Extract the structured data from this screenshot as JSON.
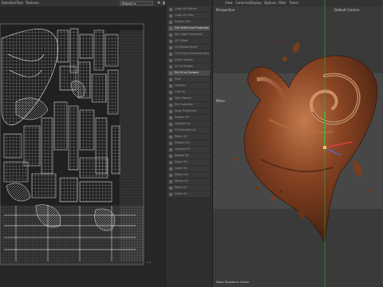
{
  "topbar": {
    "menus": [
      "Selection",
      "Tiles",
      "Textures"
    ],
    "dropdown_value": "Project",
    "icons": [
      "pin-icon",
      "grid-icon",
      "cursor-icon",
      "circle-icon"
    ]
  },
  "side_panel": {
    "items": [
      {
        "label": "Copy UV Seams",
        "highlight": false
      },
      {
        "label": "Copy UV Tiles",
        "highlight": false
      },
      {
        "label": "Project UVs",
        "highlight": false
      },
      {
        "label": "Set UVW From Projection",
        "highlight": true
      },
      {
        "label": "Set Label Projection",
        "highlight": false
      },
      {
        "label": "UV Offset",
        "highlight": false
      },
      {
        "label": "UV Rotate/Scale",
        "highlight": false
      },
      {
        "label": "UV Project Selected Item",
        "highlight": false
      },
      {
        "label": "Auto Unwrap",
        "highlight": false
      },
      {
        "label": "Fit UV Region",
        "highlight": false
      },
      {
        "label": "Fit UV to Camera",
        "highlight": true
      },
      {
        "label": "Sew",
        "highlight": false
      },
      {
        "label": "Unwrap",
        "highlight": false
      },
      {
        "label": "Line UV",
        "highlight": false
      },
      {
        "label": "Split Seams",
        "highlight": false
      },
      {
        "label": "Pin Projection",
        "highlight": false
      },
      {
        "label": "Align Projection",
        "highlight": false
      },
      {
        "label": "Isolate UV",
        "highlight": false
      },
      {
        "label": "Unweld UV",
        "highlight": false
      },
      {
        "label": "Fit Selected UV",
        "highlight": false
      },
      {
        "label": "Relax UV",
        "highlight": false
      },
      {
        "label": "Stretch UV",
        "highlight": false
      },
      {
        "label": "Unwrap UV",
        "highlight": false
      },
      {
        "label": "Rotate UV",
        "highlight": false
      },
      {
        "label": "Stack UV",
        "highlight": false
      },
      {
        "label": "Label UV",
        "highlight": false
      },
      {
        "label": "Match UV",
        "highlight": false
      },
      {
        "label": "Merge UV",
        "highlight": false
      },
      {
        "label": "Move UV",
        "highlight": false
      },
      {
        "label": "Scale UV",
        "highlight": false
      }
    ]
  },
  "viewport": {
    "menus": [
      "View",
      "Cameras",
      "Display",
      "Options",
      "Filter",
      "Panel"
    ],
    "view_label": "Perspective",
    "camera_label": "Default Camera",
    "mode_label": "Move",
    "status_label": "Move Transform: Scene",
    "colors": {
      "chocolate_dark": "#4a2410",
      "chocolate_mid": "#7a3d1f",
      "chocolate_light": "#b06a42",
      "axis_green": "#2ecc40",
      "axis_red": "#e84040",
      "axis_blue": "#4a6cf0"
    }
  }
}
